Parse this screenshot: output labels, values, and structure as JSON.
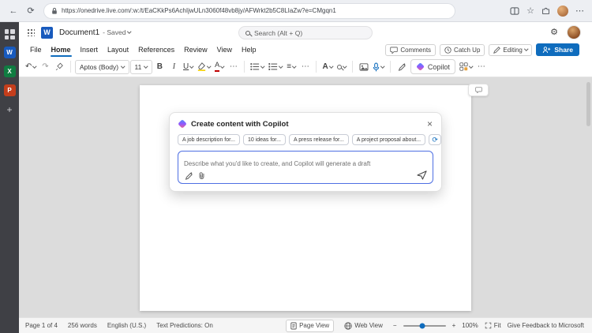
{
  "browser": {
    "url": "https://onedrive.live.com/:w:/t/EaCKkPs6AchIjwULn3060f48vb8jy/AFWrkt2b5C8LIaZw?e=CMgqn1"
  },
  "icons": {
    "back": "←",
    "refresh": "⟳",
    "star": "☆",
    "ellipsis": "⋯",
    "gear": "⚙",
    "undo": "↶",
    "redo": "↷",
    "close": "×",
    "align": "≡",
    "plus": "+",
    "minus": "−"
  },
  "edge_sidebar": {
    "word_letter": "W",
    "excel_letter": "X",
    "powerpoint_letter": "P"
  },
  "header": {
    "logo_letter": "W",
    "title": "Document1",
    "saved_text": "- Saved",
    "search_placeholder": "Search (Alt + Q)"
  },
  "menu": {
    "items": [
      "File",
      "Home",
      "Insert",
      "Layout",
      "References",
      "Review",
      "View",
      "Help"
    ],
    "comments": "Comments",
    "catch_up": "Catch Up",
    "editing": "Editing",
    "share": "Share"
  },
  "ribbon": {
    "font_name": "Aptos (Body)",
    "font_size": "11",
    "bold": "B",
    "italic": "I",
    "underline": "U",
    "font_color_letter": "A",
    "styles_letter": "A",
    "copilot_label": "Copilot"
  },
  "copilot_dialog": {
    "title": "Create content with Copilot",
    "chips": [
      "A job description for...",
      "10 ideas for...",
      "A press release for...",
      "A project proposal about..."
    ],
    "prompt_placeholder": "Describe what you'd like to create, and Copilot will generate a draft"
  },
  "status_bar": {
    "page": "Page 1 of 4",
    "words": "256 words",
    "language": "English (U.S.)",
    "predictions": "Text Predictions: On",
    "page_view": "Page View",
    "web_view": "Web View",
    "zoom": "100%",
    "fit": "Fit",
    "feedback": "Give Feedback to Microsoft"
  },
  "colors": {
    "accent": "#0f6cbd",
    "word_blue": "#185abd",
    "excel_green": "#107c41",
    "powerpoint_orange": "#c43e1c",
    "copilot_input_border": "#4e6fe3",
    "highlight_yellow": "#f5d20e",
    "font_color_red": "#c00000"
  }
}
